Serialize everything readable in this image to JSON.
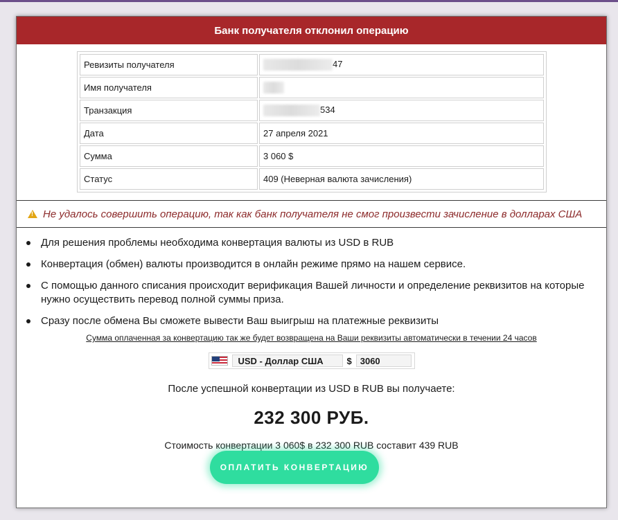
{
  "header": {
    "title": "Банк получателя отклонил операцию"
  },
  "details": [
    {
      "label": "Ревизиты получателя",
      "value": "47",
      "masked": true,
      "mask_width": 100
    },
    {
      "label": "Имя получателя",
      "value": "",
      "masked": true,
      "mask_width": 30
    },
    {
      "label": "Транзакция",
      "value": "534",
      "masked": true,
      "mask_width": 82
    },
    {
      "label": "Дата",
      "value": "27 апреля 2021",
      "masked": false
    },
    {
      "label": "Сумма",
      "value": "3 060 $",
      "masked": false
    },
    {
      "label": "Статус",
      "value": "409 (Неверная валюта зачисления)",
      "masked": false
    }
  ],
  "warning": {
    "icon": "warning-icon",
    "text": "Не удалось совершить операцию, так как банк получателя не смог произвести зачисление в долларах США"
  },
  "info_items": [
    "Для решения проблемы необходима конвертация валюты из USD в RUB",
    "Конвертация (обмен) валюты производится в онлайн режиме прямо на нашем сервисе.",
    "С помощью данного списания происходит верификация Вашей личности и определение реквизитов на которые нужно осуществить перевод полной суммы приза.",
    "Сразу после обмена Вы сможете вывести Ваш выигрыш на платежные реквизиты"
  ],
  "note": "Сумма оплаченная за конвертацию так же будет возвращена на Ваши реквизиты автоматически в течении 24 часов",
  "converter": {
    "currency": "USD - Доллар США",
    "symbol": "$",
    "amount": "3060"
  },
  "result": {
    "label": "После успешной конвертации из USD в RUB вы получаете:",
    "sum": "232 300 РУБ.",
    "cost": "Стоимость конвертации 3 060$ в 232 300 RUB составит 439 RUB"
  },
  "button": {
    "label": "ОПЛАТИТЬ КОНВЕРТАЦИЮ"
  },
  "colors": {
    "header_bg": "#a8272a",
    "button_bg": "#2fdd9f",
    "warning_text": "#8c2a2a"
  }
}
